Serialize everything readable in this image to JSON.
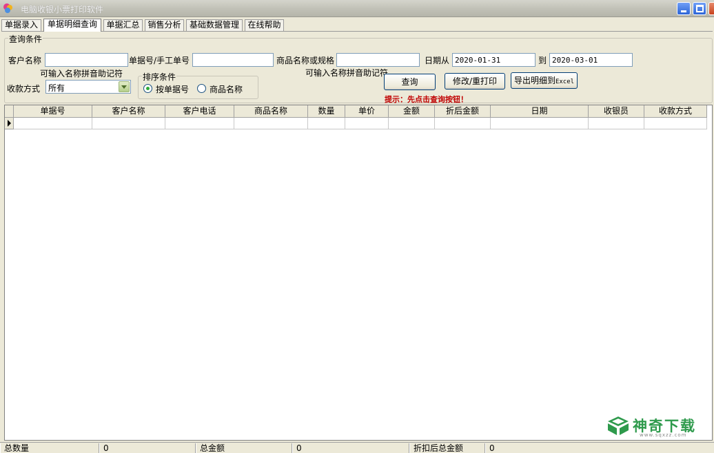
{
  "window": {
    "title": "电脑收银小票打印软件"
  },
  "tabs": [
    {
      "label": "单据录入"
    },
    {
      "label": "单据明细查询"
    },
    {
      "label": "单据汇总"
    },
    {
      "label": "销售分析"
    },
    {
      "label": "基础数据管理"
    },
    {
      "label": "在线帮助"
    }
  ],
  "query": {
    "group_title": "查询条件",
    "customer_label": "客户名称",
    "customer_value": "",
    "order_no_label": "单据号/手工单号",
    "order_no_value": "",
    "product_label": "商品名称或规格",
    "product_value": "",
    "date_from_label": "日期从",
    "date_from_value": "2020-01-31",
    "date_to_label": "到",
    "date_to_value": "2020-03-01",
    "customer_hint": "可输入名称拼音助记符",
    "product_hint": "可输入名称拼音助记符",
    "payment_label": "收款方式",
    "payment_value": "所有",
    "sort_title": "排序条件",
    "sort_options": [
      "按单据号",
      "商品名称"
    ],
    "sort_selected": "按单据号",
    "query_button": "查询",
    "reprint_button": "修改/重打印",
    "export_button": "导出明细到",
    "export_button_suffix": "Excel",
    "tip": "提示：先点击查询按钮！"
  },
  "grid": {
    "columns": [
      "单据号",
      "客户名称",
      "客户电话",
      "商品名称",
      "数量",
      "单价",
      "金额",
      "折后金额",
      "日期",
      "收银员",
      "收款方式"
    ],
    "rows": []
  },
  "watermark": {
    "text": "神奇下载",
    "url": "www.sqxzz.com"
  },
  "status": {
    "total_qty_label": "总数量",
    "total_qty_value": "0",
    "total_amount_label": "总金额",
    "total_amount_value": "0",
    "discount_total_label": "折扣后总金额",
    "discount_total_value": "0"
  },
  "colors": {
    "accent": "#2e9a4c",
    "tip": "#c00000",
    "titlebar": "#c2c2b8"
  }
}
